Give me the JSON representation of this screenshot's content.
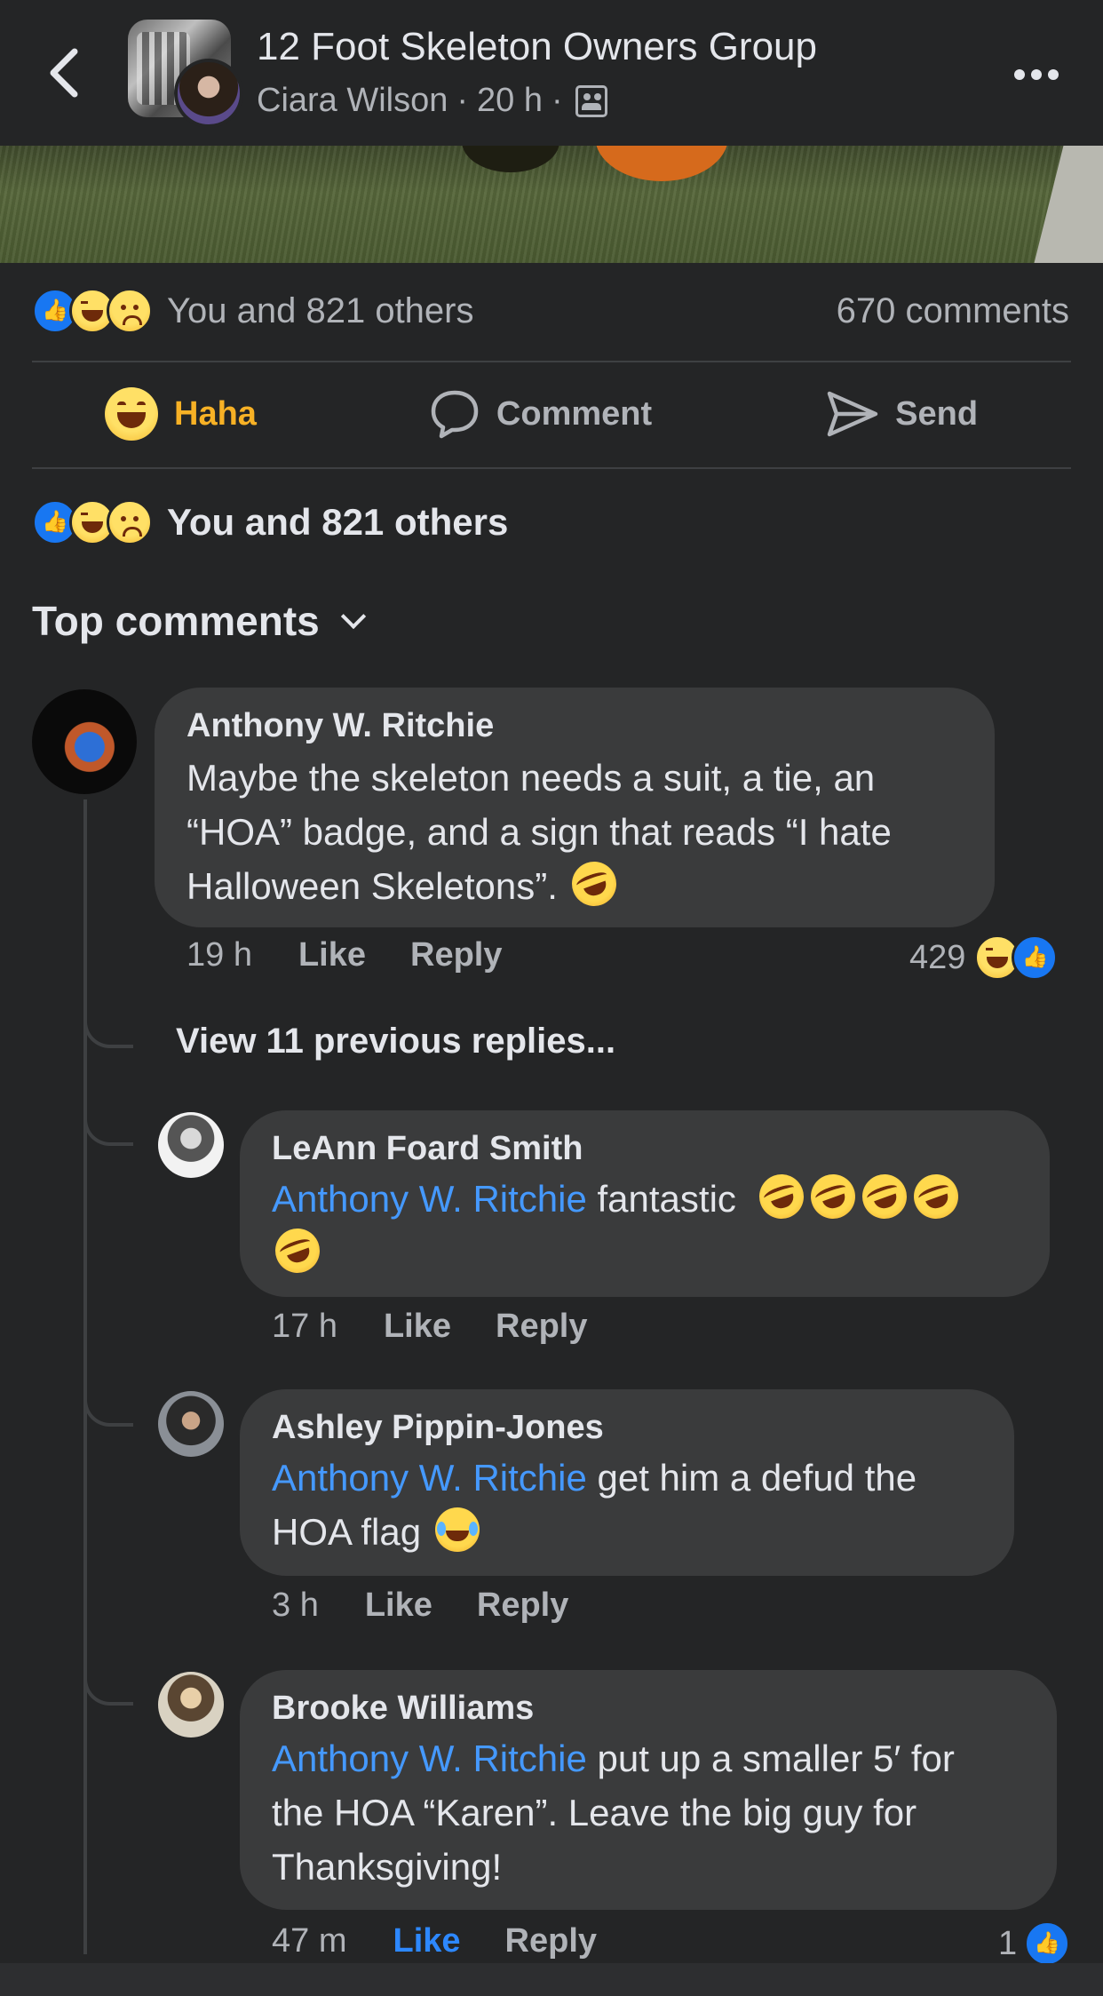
{
  "header": {
    "group_name": "12 Foot Skeleton Owners Group",
    "author": "Ciara Wilson",
    "time": "20 h",
    "separator": "·",
    "back_icon": "chevron-left-icon",
    "privacy_icon": "group-members-icon",
    "more_icon": "more-horizontal-icon"
  },
  "reactions": {
    "summary": "You and 821 others",
    "comments": "670 comments",
    "icons": [
      "like-icon",
      "haha-icon",
      "sad-icon"
    ]
  },
  "actions": {
    "haha": "Haha",
    "comment": "Comment",
    "send": "Send"
  },
  "reactions_detail": {
    "summary": "You and 821 others"
  },
  "top_comments": {
    "label": "Top comments"
  },
  "comments": [
    {
      "name": "Anthony W. Ritchie",
      "line1": "Maybe the skeleton needs a suit, a tie, an",
      "line2": "“HOA” badge, and a sign that reads “I hate",
      "line3": "Halloween Skeletons”.",
      "time": "19 h",
      "like": "Like",
      "reply": "Reply",
      "reaction_count": "429"
    }
  ],
  "view_previous": "View 11 previous replies...",
  "replies": [
    {
      "name": "LeAnn Foard Smith",
      "mention": "Anthony W. Ritchie",
      "text": " fantastic",
      "time": "17 h",
      "like": "Like",
      "reply": "Reply"
    },
    {
      "name": "Ashley Pippin-Jones",
      "mention": "Anthony W. Ritchie",
      "text": " get him a defud the",
      "text2": "HOA flag",
      "time": "3 h",
      "like": "Like",
      "reply": "Reply"
    },
    {
      "name": "Brooke Williams",
      "mention": "Anthony W. Ritchie",
      "text": " put up a smaller 5′ for",
      "text2": "the HOA “Karen”. Leave the big guy for",
      "text3": "Thanksgiving!",
      "time": "47 m",
      "like": "Like",
      "reply": "Reply",
      "reaction_count": "1"
    }
  ],
  "colors": {
    "background": "#242526",
    "bubble": "#3a3b3c",
    "mention": "#4599ff",
    "haha_accent": "#f7b125",
    "like_blue": "#1877f2"
  }
}
